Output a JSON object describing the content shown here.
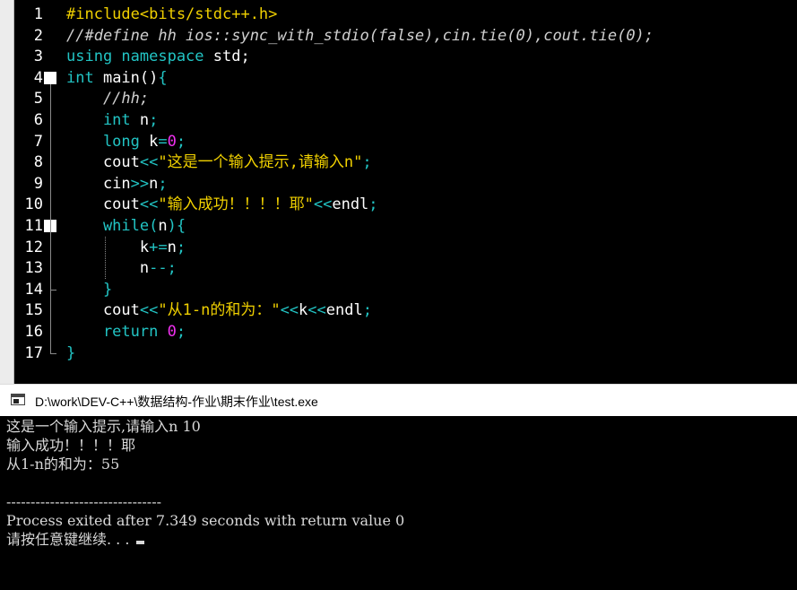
{
  "editor": {
    "lines": [
      {
        "num": "1",
        "tokens": [
          {
            "t": "#include<bits/stdc++.h>",
            "c": "c-inc"
          }
        ]
      },
      {
        "num": "2",
        "tokens": [
          {
            "t": "//#define hh ios::sync_with_stdio(false),cin.tie(0),cout.tie(0);",
            "c": "c-cm"
          }
        ]
      },
      {
        "num": "3",
        "tokens": [
          {
            "t": "using namespace",
            "c": "c-kw"
          },
          {
            "t": " std;",
            "c": "c-id"
          }
        ]
      },
      {
        "num": "4",
        "tokens": [
          {
            "t": "int",
            "c": "c-kw"
          },
          {
            "t": " main()",
            "c": "c-id"
          },
          {
            "t": "{",
            "c": "c-op"
          }
        ]
      },
      {
        "num": "5",
        "tokens": [
          {
            "t": "    //hh;",
            "c": "c-cm"
          }
        ]
      },
      {
        "num": "6",
        "tokens": [
          {
            "t": "    int",
            "c": "c-kw"
          },
          {
            "t": " n",
            "c": "c-id"
          },
          {
            "t": ";",
            "c": "c-op"
          }
        ]
      },
      {
        "num": "7",
        "tokens": [
          {
            "t": "    long",
            "c": "c-kw"
          },
          {
            "t": " k",
            "c": "c-id"
          },
          {
            "t": "=",
            "c": "c-op"
          },
          {
            "t": "0",
            "c": "c-num"
          },
          {
            "t": ";",
            "c": "c-op"
          }
        ]
      },
      {
        "num": "8",
        "tokens": [
          {
            "t": "    cout",
            "c": "c-id"
          },
          {
            "t": "<<",
            "c": "c-op"
          },
          {
            "t": "\"这是一个输入提示,请输入n\"",
            "c": "c-str"
          },
          {
            "t": ";",
            "c": "c-op"
          }
        ]
      },
      {
        "num": "9",
        "tokens": [
          {
            "t": "    cin",
            "c": "c-id"
          },
          {
            "t": ">>",
            "c": "c-op"
          },
          {
            "t": "n",
            "c": "c-id"
          },
          {
            "t": ";",
            "c": "c-op"
          }
        ]
      },
      {
        "num": "10",
        "tokens": [
          {
            "t": "    cout",
            "c": "c-id"
          },
          {
            "t": "<<",
            "c": "c-op"
          },
          {
            "t": "\"输入成功！！！！耶\"",
            "c": "c-str"
          },
          {
            "t": "<<",
            "c": "c-op"
          },
          {
            "t": "endl",
            "c": "c-id"
          },
          {
            "t": ";",
            "c": "c-op"
          }
        ]
      },
      {
        "num": "11",
        "tokens": [
          {
            "t": "    while",
            "c": "c-kw"
          },
          {
            "t": "(",
            "c": "c-op"
          },
          {
            "t": "n",
            "c": "c-id"
          },
          {
            "t": "){",
            "c": "c-op"
          }
        ]
      },
      {
        "num": "12",
        "tokens": [
          {
            "t": "        k",
            "c": "c-id"
          },
          {
            "t": "+=",
            "c": "c-op"
          },
          {
            "t": "n",
            "c": "c-id"
          },
          {
            "t": ";",
            "c": "c-op"
          }
        ]
      },
      {
        "num": "13",
        "tokens": [
          {
            "t": "        n",
            "c": "c-id"
          },
          {
            "t": "--;",
            "c": "c-op"
          }
        ]
      },
      {
        "num": "14",
        "tokens": [
          {
            "t": "    }",
            "c": "c-op"
          }
        ]
      },
      {
        "num": "15",
        "tokens": [
          {
            "t": "    cout",
            "c": "c-id"
          },
          {
            "t": "<<",
            "c": "c-op"
          },
          {
            "t": "\"从1-n的和为：\"",
            "c": "c-str"
          },
          {
            "t": "<<",
            "c": "c-op"
          },
          {
            "t": "k",
            "c": "c-id"
          },
          {
            "t": "<<",
            "c": "c-op"
          },
          {
            "t": "endl",
            "c": "c-id"
          },
          {
            "t": ";",
            "c": "c-op"
          }
        ]
      },
      {
        "num": "16",
        "tokens": [
          {
            "t": "    return",
            "c": "c-kw"
          },
          {
            "t": " ",
            "c": "c-id"
          },
          {
            "t": "0",
            "c": "c-num"
          },
          {
            "t": ";",
            "c": "c-op"
          }
        ]
      },
      {
        "num": "17",
        "tokens": [
          {
            "t": "}",
            "c": "c-op"
          }
        ]
      }
    ],
    "fold_markers": [
      {
        "line": "4",
        "kind": "open"
      },
      {
        "line": "11",
        "kind": "open"
      },
      {
        "line": "14",
        "kind": "close"
      },
      {
        "line": "17",
        "kind": "close"
      }
    ]
  },
  "console": {
    "title": "D:\\work\\DEV-C++\\数据结构-作业\\期末作业\\test.exe",
    "icon": "console-window-icon",
    "lines": [
      "这是一个输入提示,请输入n 10",
      "输入成功！！！！耶",
      "从1-n的和为：55",
      "",
      "--------------------------------",
      "Process exited after 7.349 seconds with return value 0",
      "请按任意键继续. . . "
    ]
  }
}
